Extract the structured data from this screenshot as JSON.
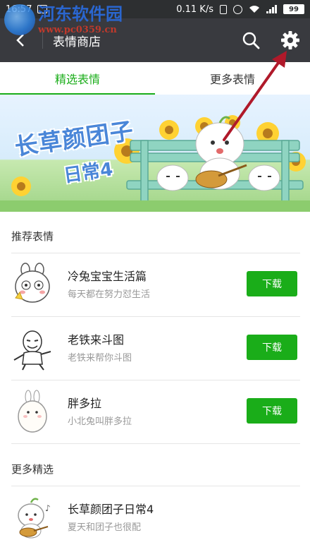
{
  "status_bar": {
    "time": "16:57",
    "net_speed": "0.11 K/s",
    "battery": "99"
  },
  "app_bar": {
    "back_icon": "back-arrow-icon",
    "title": "表情商店",
    "search_icon": "search-icon",
    "settings_icon": "gear-icon"
  },
  "watermark": {
    "title": "河东软件园",
    "url": "www.pc0359.cn"
  },
  "tabs": [
    {
      "label": "精选表情",
      "active": true
    },
    {
      "label": "更多表情",
      "active": false
    }
  ],
  "banner": {
    "title": "长草颜团子",
    "subtitle": "日常4"
  },
  "sections": {
    "recommended": "推荐表情",
    "more": "更多精选"
  },
  "recommended_items": [
    {
      "title": "冷兔宝宝生活篇",
      "subtitle": "每天都在努力怼生活",
      "button": "下载"
    },
    {
      "title": "老铁来斗图",
      "subtitle": "老铁来帮你斗图",
      "button": "下载"
    },
    {
      "title": "胖多拉",
      "subtitle": "小北兔叫胖多拉",
      "button": "下载"
    }
  ],
  "more_items": [
    {
      "title": "长草颜团子日常4",
      "subtitle": "夏天和团子也很配"
    }
  ],
  "colors": {
    "accent": "#1aad19",
    "app_bar": "#393a3f",
    "arrow": "#b0192a"
  }
}
